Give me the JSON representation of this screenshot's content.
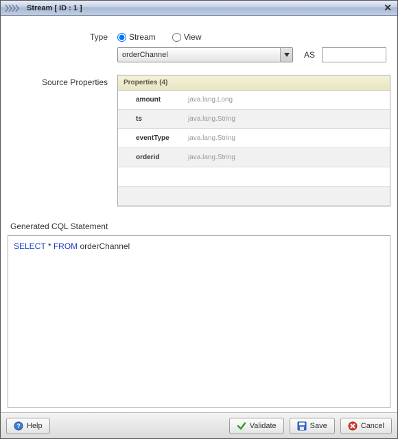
{
  "titlebar": {
    "title": "Stream [ ID : 1 ]"
  },
  "form": {
    "type_label": "Type",
    "radio_stream": "Stream",
    "radio_view": "View",
    "select_value": "orderChannel",
    "as_label": "AS",
    "as_value": "",
    "source_props_label": "Source Properties",
    "props_header": "Properties (4)",
    "props": [
      {
        "name": "amount",
        "type": "java.lang.Long"
      },
      {
        "name": "ts",
        "type": "java.lang.String"
      },
      {
        "name": "eventType",
        "type": "java.lang.String"
      },
      {
        "name": "orderid",
        "type": "java.lang.String"
      }
    ],
    "gen_cql_label": "Generated CQL Statement",
    "cql_select": "SELECT",
    "cql_star": "*",
    "cql_from": "FROM",
    "cql_source": "orderChannel"
  },
  "footer": {
    "help": "Help",
    "validate": "Validate",
    "save": "Save",
    "cancel": "Cancel"
  }
}
